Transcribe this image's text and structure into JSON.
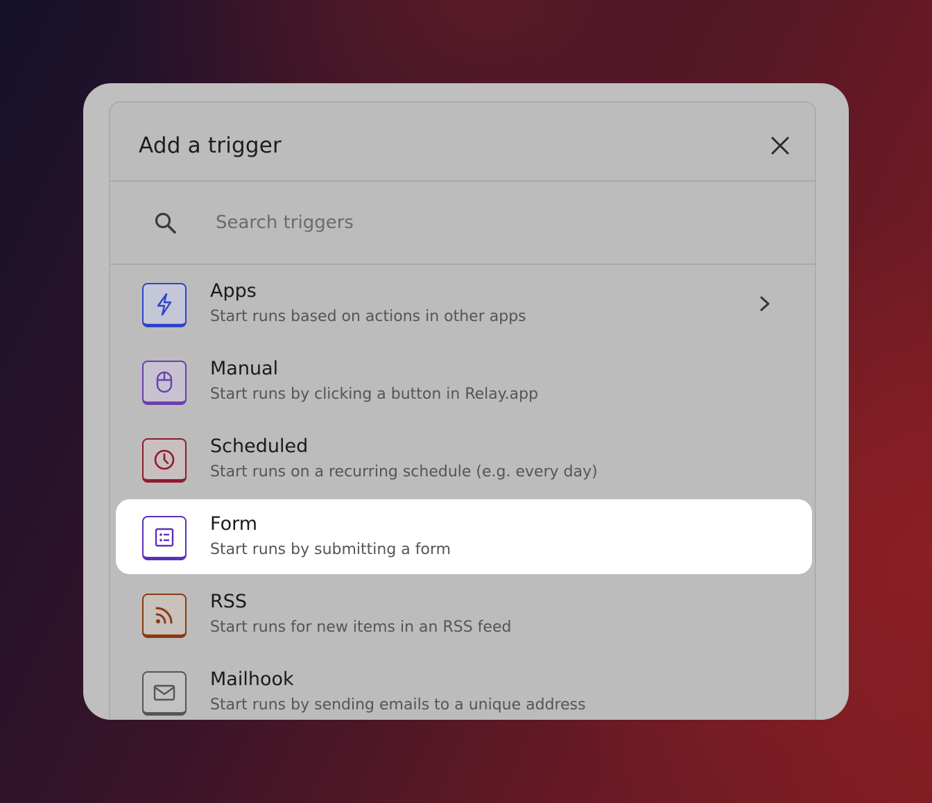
{
  "dialog": {
    "title": "Add a trigger",
    "close_icon": "close-icon"
  },
  "search": {
    "placeholder": "Search triggers",
    "value": "",
    "icon": "search-icon"
  },
  "triggers": [
    {
      "name": "Apps",
      "description": "Start runs based on actions in other apps",
      "icon": "lightning-icon",
      "color": "#2f45c9",
      "has_chevron": true,
      "selected": false
    },
    {
      "name": "Manual",
      "description": "Start runs by clicking a button in Relay.app",
      "icon": "mouse-icon",
      "color": "#6a3fae",
      "has_chevron": false,
      "selected": false
    },
    {
      "name": "Scheduled",
      "description": "Start runs on a recurring schedule (e.g. every day)",
      "icon": "clock-icon",
      "color": "#8e1a2e",
      "has_chevron": false,
      "selected": false
    },
    {
      "name": "Form",
      "description": "Start runs by submitting a form",
      "icon": "form-icon",
      "color": "#5b2fb8",
      "has_chevron": false,
      "selected": true
    },
    {
      "name": "RSS",
      "description": "Start runs for new items in an RSS feed",
      "icon": "rss-icon",
      "color": "#8a3a12",
      "has_chevron": false,
      "selected": false
    },
    {
      "name": "Mailhook",
      "description": "Start runs by sending emails to a unique address",
      "icon": "mail-icon",
      "color": "#555555",
      "has_chevron": false,
      "selected": false
    }
  ]
}
